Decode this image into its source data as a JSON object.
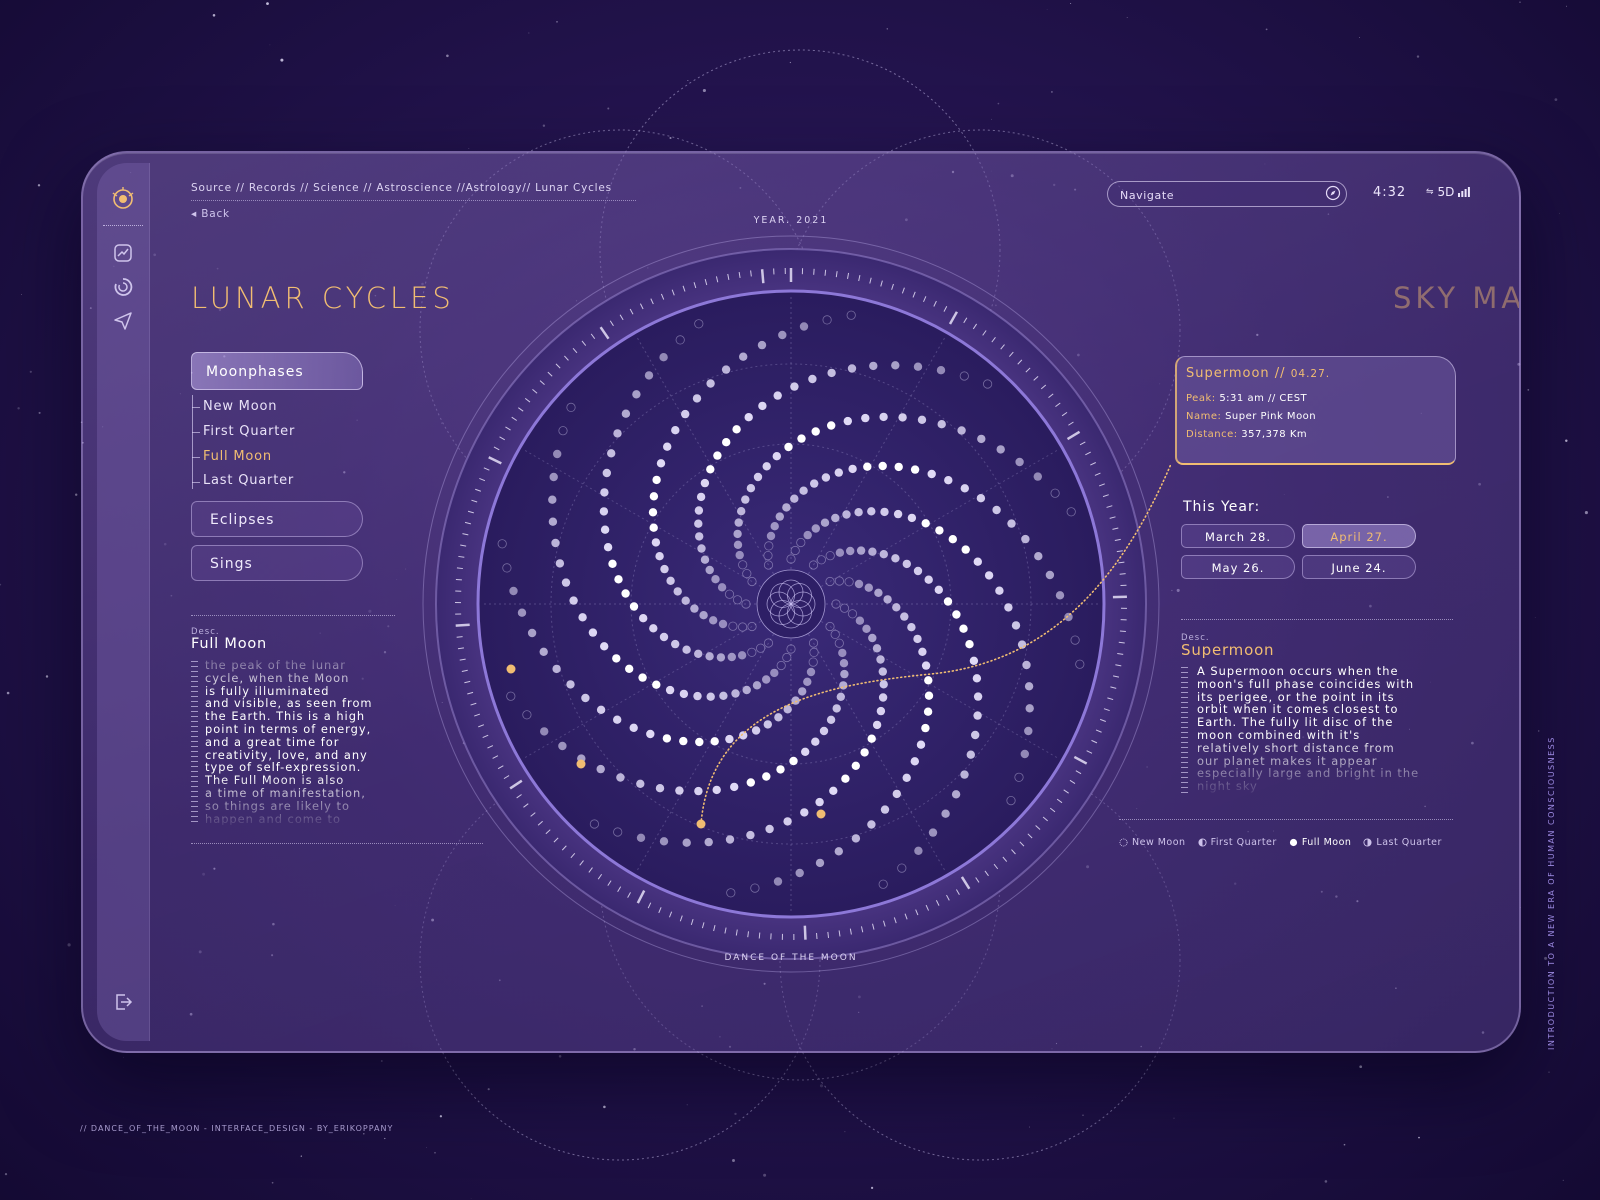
{
  "breadcrumb": "Source // Records // Science // Astroscience //Astrology// Lunar Cycles",
  "back_label": "Back",
  "search": {
    "placeholder": "Navigate"
  },
  "status": {
    "time": "4:32",
    "network": "5D"
  },
  "page_title": "LUNAR CYCLES",
  "next_page_title": "SKY MA",
  "menu": {
    "main": "Moonphases",
    "sub_items": [
      {
        "label": "New Moon",
        "active": false
      },
      {
        "label": "First Quarter",
        "active": false
      },
      {
        "label": "Full Moon",
        "active": true
      },
      {
        "label": "Last Quarter",
        "active": false
      }
    ],
    "eclipses": "Eclipses",
    "sings": "Sings"
  },
  "left_desc": {
    "label": "Desc.",
    "title": "Full Moon",
    "lines": [
      "the peak of the lunar",
      "cycle, when the Moon",
      "is fully illuminated",
      "and visible, as seen from",
      "the Earth. This is a high",
      "point in terms of energy,",
      "and a great time for",
      "creativity, love, and any",
      "type of self-expression.",
      "The Full Moon is also",
      "a time of manifestation,",
      "so things are likely to",
      "happen and come to"
    ]
  },
  "dial": {
    "year_label": "YEAR. 2021",
    "bottom_label": "DANCE OF THE MOON"
  },
  "info_card": {
    "title": "Supermoon // ",
    "title_date": "04.27.",
    "peak_label": "Peak:",
    "peak_value": "5:31 am // CEST",
    "name_label": "Name:",
    "name_value": "Super Pink Moon",
    "distance_label": "Distance:",
    "distance_value": "357,378 Km"
  },
  "this_year": {
    "label": "This Year:",
    "dates": [
      {
        "label": "March 28.",
        "active": false
      },
      {
        "label": "April 27.",
        "active": true
      },
      {
        "label": "May 26.",
        "active": false
      },
      {
        "label": "June 24.",
        "active": false
      }
    ]
  },
  "right_desc": {
    "label": "Desc.",
    "title": "Supermoon",
    "lines": [
      "A Supermoon occurs when the",
      "moon's full phase coincides with",
      "its perigee, or the point in its",
      "orbit when it comes closest to",
      "Earth. The fully lit disc of the",
      "moon combined with it's",
      "relatively short distance from",
      "our planet makes it appear",
      "especially large and bright in the",
      "night sky"
    ]
  },
  "legend": [
    "New Moon",
    "First Quarter",
    "Full Moon",
    "Last Quarter"
  ],
  "footer": "// DANCE_OF_THE_MOON - INTERFACE_DESIGN - BY_ERIKOPPANY",
  "vertical_tagline": "INTRODUCTION TO A NEW ERA OF HUMAN CONSCIOUSNESS",
  "colors": {
    "accent": "#f1bd72",
    "panel": "#5d4394",
    "background": "#1c0f44"
  },
  "icons": [
    "logo-icon",
    "chart-icon",
    "cycle-icon",
    "send-icon",
    "logout-icon",
    "compass-icon",
    "signal-icon"
  ]
}
